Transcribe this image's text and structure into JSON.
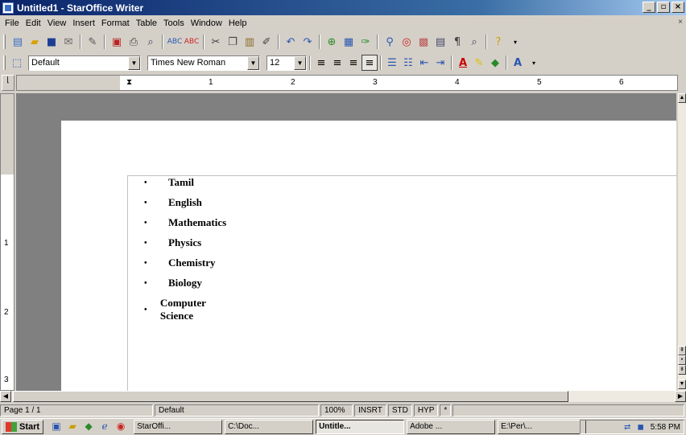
{
  "window": {
    "title": "Untitled1 - StarOffice Writer",
    "min": "_",
    "max": "▫",
    "close": "×"
  },
  "menubar": {
    "items": [
      "File",
      "Edit",
      "View",
      "Insert",
      "Format",
      "Table",
      "Tools",
      "Window",
      "Help"
    ],
    "close": "×"
  },
  "format_bar": {
    "style": "Default",
    "font": "Times New Roman",
    "size": "12"
  },
  "ruler": {
    "h_numbers": [
      "1",
      "2",
      "3",
      "4",
      "5",
      "6"
    ],
    "v_numbers": [
      "1",
      "2",
      "3"
    ]
  },
  "document": {
    "items": [
      "Tamil",
      "English",
      "Mathematics",
      "Physics",
      "Chemistry",
      "Biology",
      "Computer Science"
    ]
  },
  "statusbar": {
    "page": "Page 1 / 1",
    "style": "Default",
    "zoom": "100%",
    "insert": "INSRT",
    "selection": "STD",
    "hyphen": "HYP",
    "modified": "*"
  },
  "taskbar": {
    "start": "Start",
    "tasks": [
      "StarOffi...",
      "C:\\Doc...",
      "Untitle...",
      "Adobe ...",
      "E:\\Per\\..."
    ],
    "clock": "5:58 PM"
  }
}
